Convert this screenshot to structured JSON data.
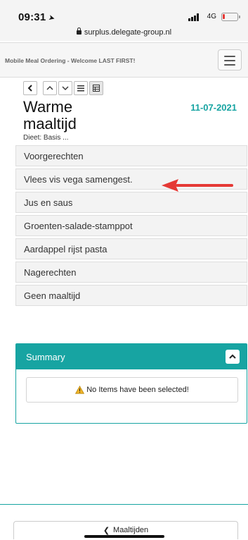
{
  "status_bar": {
    "time": "09:31",
    "network": "4G"
  },
  "browser": {
    "url": "surplus.delegate-group.nl"
  },
  "header": {
    "title": "Mobile Meal Ordering - Welcome LAST FIRST!"
  },
  "meal": {
    "title": "Warme maaltijd",
    "date": "11-07-2021",
    "diet": "Dieet: Basis ..."
  },
  "categories": [
    {
      "label": "Voorgerechten"
    },
    {
      "label": "Vlees vis vega samengest."
    },
    {
      "label": "Jus en saus"
    },
    {
      "label": "Groenten-salade-stamppot"
    },
    {
      "label": "Aardappel rijst pasta"
    },
    {
      "label": "Nagerechten"
    },
    {
      "label": "Geen maaltijd"
    }
  ],
  "summary": {
    "title": "Summary",
    "empty_message": "No Items have been selected!"
  },
  "footer": {
    "back_label": "Maaltijden"
  },
  "colors": {
    "accent": "#17a4a2",
    "annotation_arrow": "#e53935",
    "battery": "#e53935"
  }
}
